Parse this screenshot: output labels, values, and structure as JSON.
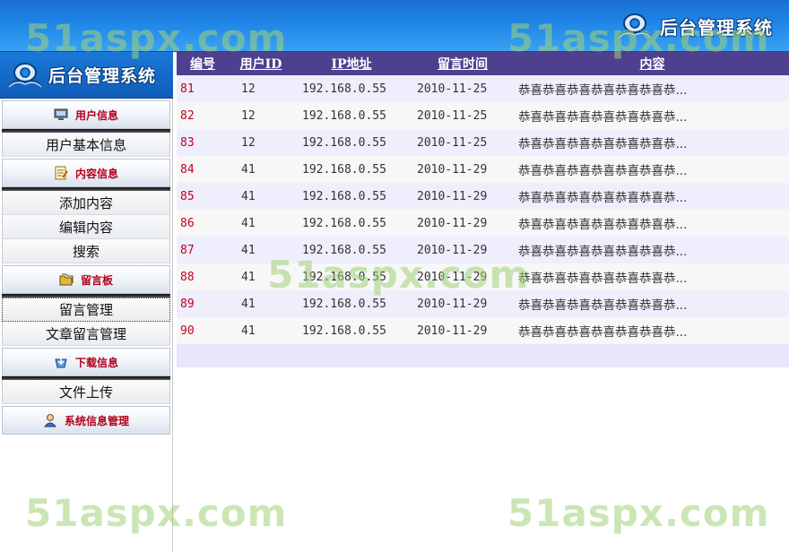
{
  "app": {
    "title": "后台管理系统"
  },
  "sidebar": {
    "sections": [
      {
        "label": "用户信息",
        "icon": "monitor-icon",
        "items": [
          "用户基本信息"
        ]
      },
      {
        "label": "内容信息",
        "icon": "notepad-icon",
        "items": [
          "添加内容",
          "编辑内容",
          "搜索"
        ]
      },
      {
        "label": "留言板",
        "icon": "folders-icon",
        "items": [
          "留言管理",
          "文章留言管理"
        ]
      },
      {
        "label": "下载信息",
        "icon": "download-icon",
        "items": [
          "文件上传"
        ]
      },
      {
        "label": "系统信息管理",
        "icon": "user-icon",
        "items": []
      }
    ],
    "active_item": "留言管理"
  },
  "table": {
    "headers": [
      "编号",
      "用户ID",
      "IP地址",
      "留言时间",
      "内容"
    ],
    "rows": [
      {
        "id": "81",
        "uid": "12",
        "ip": "192.168.0.55",
        "date": "2010-11-25",
        "content": "恭喜恭喜恭喜恭喜恭喜恭喜恭..."
      },
      {
        "id": "82",
        "uid": "12",
        "ip": "192.168.0.55",
        "date": "2010-11-25",
        "content": "恭喜恭喜恭喜恭喜恭喜恭喜恭..."
      },
      {
        "id": "83",
        "uid": "12",
        "ip": "192.168.0.55",
        "date": "2010-11-25",
        "content": "恭喜恭喜恭喜恭喜恭喜恭喜恭..."
      },
      {
        "id": "84",
        "uid": "41",
        "ip": "192.168.0.55",
        "date": "2010-11-29",
        "content": "恭喜恭喜恭喜恭喜恭喜恭喜恭..."
      },
      {
        "id": "85",
        "uid": "41",
        "ip": "192.168.0.55",
        "date": "2010-11-29",
        "content": "恭喜恭喜恭喜恭喜恭喜恭喜恭..."
      },
      {
        "id": "86",
        "uid": "41",
        "ip": "192.168.0.55",
        "date": "2010-11-29",
        "content": "恭喜恭喜恭喜恭喜恭喜恭喜恭..."
      },
      {
        "id": "87",
        "uid": "41",
        "ip": "192.168.0.55",
        "date": "2010-11-29",
        "content": "恭喜恭喜恭喜恭喜恭喜恭喜恭..."
      },
      {
        "id": "88",
        "uid": "41",
        "ip": "192.168.0.55",
        "date": "2010-11-29",
        "content": "恭喜恭喜恭喜恭喜恭喜恭喜恭..."
      },
      {
        "id": "89",
        "uid": "41",
        "ip": "192.168.0.55",
        "date": "2010-11-29",
        "content": "恭喜恭喜恭喜恭喜恭喜恭喜恭..."
      },
      {
        "id": "90",
        "uid": "41",
        "ip": "192.168.0.55",
        "date": "2010-11-29",
        "content": "恭喜恭喜恭喜恭喜恭喜恭喜恭..."
      }
    ]
  },
  "watermark": "51aspx.com",
  "colors": {
    "banner": "#1e86e6",
    "table_header": "#4e3f8f",
    "id_text": "#c0001c",
    "section_label": "#b3001b",
    "row_odd": "#eeeefc",
    "row_even": "#f7f7f7",
    "watermark": "#a0d278"
  }
}
